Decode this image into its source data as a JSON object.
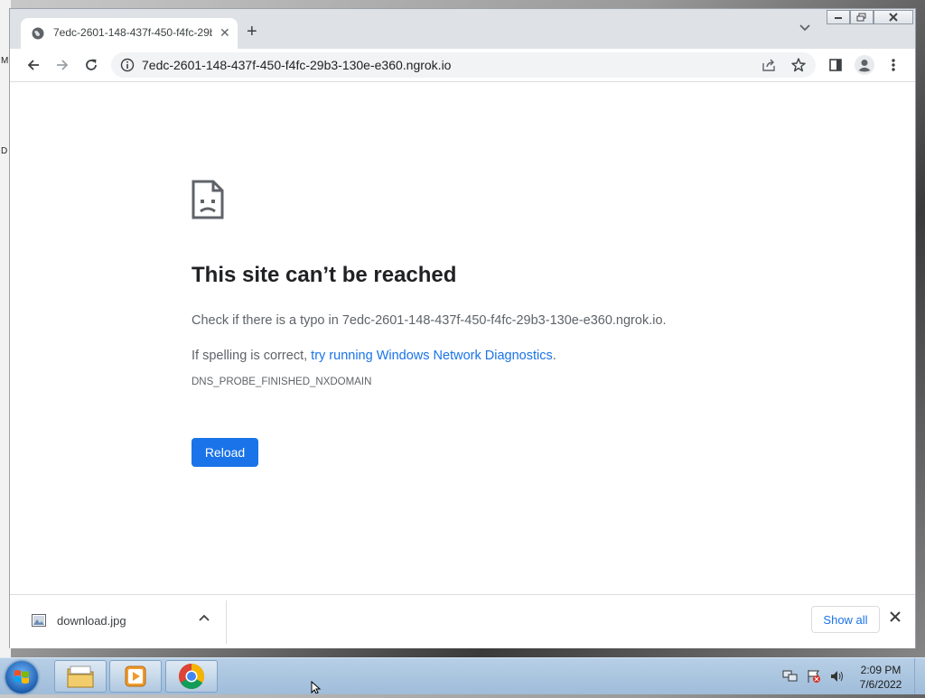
{
  "browser": {
    "tab_title": "7edc-2601-148-437f-450-f4fc-29b3-130e-e360.ngrok.io",
    "url": "7edc-2601-148-437f-450-f4fc-29b3-130e-e360.ngrok.io",
    "new_tab_label": "+",
    "tab_close_label": "✕"
  },
  "error_page": {
    "heading": "This site can’t be reached",
    "typo_prefix": "Check if there is a typo in ",
    "typo_domain": "7edc-2601-148-437f-450-f4fc-29b3-130e-e360.ngrok.io",
    "typo_suffix": ".",
    "spelling_prefix": "If spelling is correct, ",
    "diagnostics_link": "try running Windows Network Diagnostics",
    "spelling_suffix": ".",
    "error_code": "DNS_PROBE_FINISHED_NXDOMAIN",
    "reload_label": "Reload"
  },
  "download_shelf": {
    "file_name": "download.jpg",
    "show_all_label": "Show all"
  },
  "taskbar": {
    "time": "2:09 PM",
    "date": "7/6/2022",
    "pinned": [
      "windows-explorer-icon",
      "media-player-icon",
      "chrome-icon"
    ]
  },
  "colors": {
    "accent": "#1a73e8",
    "tab_strip": "#dee1e6",
    "text": "#202124"
  }
}
